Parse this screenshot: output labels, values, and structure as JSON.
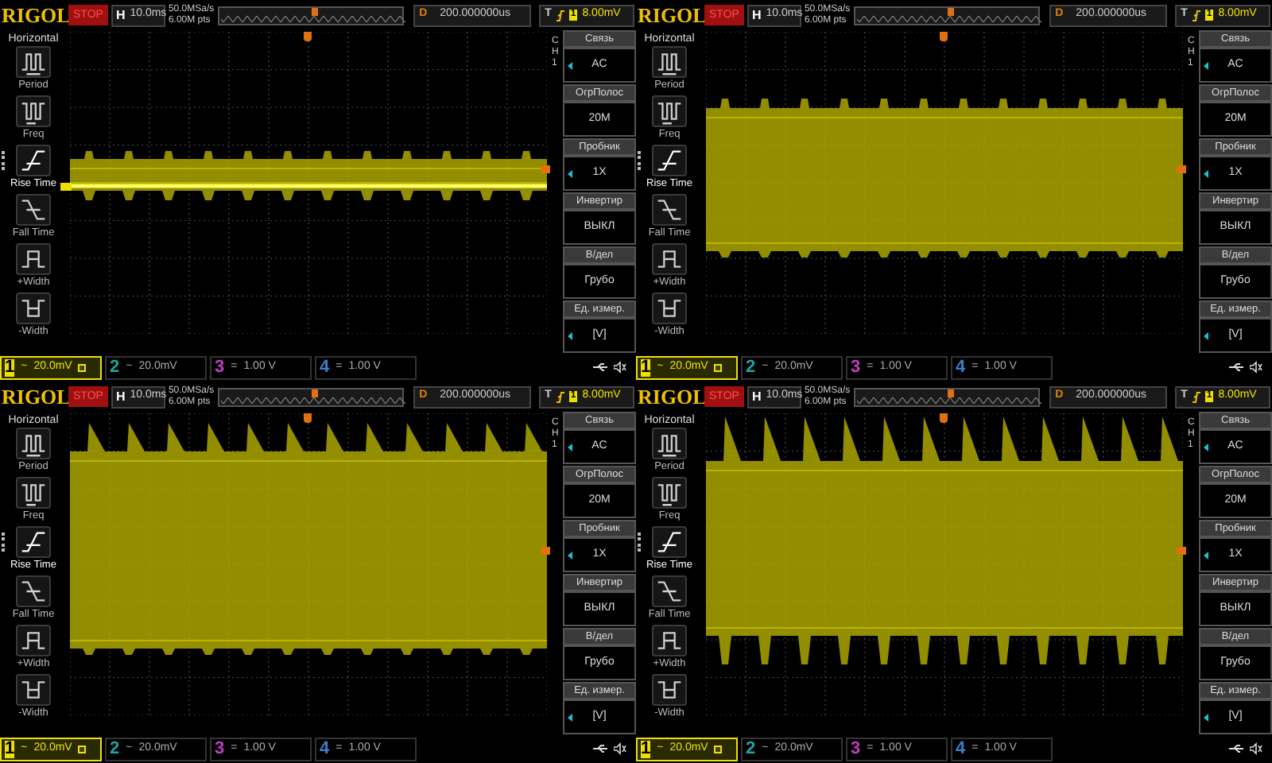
{
  "panels": [
    {
      "header": {
        "logo": "RIGOL",
        "run_state": "STOP",
        "timebase_label": "H",
        "timebase": "10.0ms",
        "sample_rate": "50.0MSa/s",
        "memory_depth": "6.00M pts",
        "delay_label": "D",
        "delay": "200.000000us",
        "trigger_label": "T",
        "trigger_source": "1",
        "trigger_level": "8.00mV"
      },
      "sidebar": {
        "title": "Horizontal",
        "items": [
          {
            "label": "Period",
            "kind": "period",
            "selected": false
          },
          {
            "label": "Freq",
            "kind": "freq",
            "selected": false
          },
          {
            "label": "Rise Time",
            "kind": "rise",
            "selected": true
          },
          {
            "label": "Fall Time",
            "kind": "fall",
            "selected": false
          },
          {
            "label": "+Width",
            "kind": "pwidth",
            "selected": false
          },
          {
            "label": "-Width",
            "kind": "nwidth",
            "selected": false
          }
        ]
      },
      "trace": {
        "kind": "ripple"
      },
      "channel_marker": true,
      "channel_label": "CH1",
      "menu": [
        {
          "title": "Связь",
          "value": "AC",
          "adjustable": true
        },
        {
          "title": "ОгрПолос",
          "value": "20M",
          "adjustable": false
        },
        {
          "title": "Пробник",
          "value": "1X",
          "adjustable": true
        },
        {
          "title": "Инвертир",
          "value": "ВЫКЛ",
          "adjustable": false
        },
        {
          "title": "В/дел",
          "value": "Грубо",
          "adjustable": false
        },
        {
          "title": "Ед. измер.",
          "value": "[V]",
          "adjustable": true
        }
      ],
      "channels": [
        {
          "number": "1",
          "coupling": "~",
          "scale": "20.0mV",
          "bw_limit": true,
          "selected": true,
          "color": "#f0e000"
        },
        {
          "number": "2",
          "coupling": "~",
          "scale": "20.0mV",
          "bw_limit": false,
          "selected": false,
          "color": "#1fa7a0"
        },
        {
          "number": "3",
          "coupling": "=",
          "scale": "1.00 V",
          "bw_limit": false,
          "selected": false,
          "color": "#c040c0"
        },
        {
          "number": "4",
          "coupling": "=",
          "scale": "1.00 V",
          "bw_limit": false,
          "selected": false,
          "color": "#3a7fd0"
        }
      ]
    },
    {
      "header": {
        "logo": "RIGOL",
        "run_state": "STOP",
        "timebase_label": "H",
        "timebase": "10.0ms",
        "sample_rate": "50.0MSa/s",
        "memory_depth": "6.00M pts",
        "delay_label": "D",
        "delay": "200.000000us",
        "trigger_label": "T",
        "trigger_source": "1",
        "trigger_level": "8.00mV"
      },
      "sidebar": {
        "title": "Horizontal",
        "items": [
          {
            "label": "Period",
            "kind": "period",
            "selected": false
          },
          {
            "label": "Freq",
            "kind": "freq",
            "selected": false
          },
          {
            "label": "Rise Time",
            "kind": "rise",
            "selected": true
          },
          {
            "label": "Fall Time",
            "kind": "fall",
            "selected": false
          },
          {
            "label": "+Width",
            "kind": "pwidth",
            "selected": false
          },
          {
            "label": "-Width",
            "kind": "nwidth",
            "selected": false
          }
        ]
      },
      "trace": {
        "kind": "band"
      },
      "channel_marker": false,
      "channel_label": "CH1",
      "menu": [
        {
          "title": "Связь",
          "value": "AC",
          "adjustable": true
        },
        {
          "title": "ОгрПолос",
          "value": "20M",
          "adjustable": false
        },
        {
          "title": "Пробник",
          "value": "1X",
          "adjustable": true
        },
        {
          "title": "Инвертир",
          "value": "ВЫКЛ",
          "adjustable": false
        },
        {
          "title": "В/дел",
          "value": "Грубо",
          "adjustable": false
        },
        {
          "title": "Ед. измер.",
          "value": "[V]",
          "adjustable": true
        }
      ],
      "channels": [
        {
          "number": "1",
          "coupling": "~",
          "scale": "20.0mV",
          "bw_limit": true,
          "selected": true,
          "color": "#f0e000"
        },
        {
          "number": "2",
          "coupling": "~",
          "scale": "20.0mV",
          "bw_limit": false,
          "selected": false,
          "color": "#1fa7a0"
        },
        {
          "number": "3",
          "coupling": "=",
          "scale": "1.00 V",
          "bw_limit": false,
          "selected": false,
          "color": "#c040c0"
        },
        {
          "number": "4",
          "coupling": "=",
          "scale": "1.00 V",
          "bw_limit": false,
          "selected": false,
          "color": "#3a7fd0"
        }
      ]
    },
    {
      "header": {
        "logo": "RIGOL",
        "run_state": "STOP",
        "timebase_label": "H",
        "timebase": "10.0ms",
        "sample_rate": "50.0MSa/s",
        "memory_depth": "6.00M pts",
        "delay_label": "D",
        "delay": "200.000000us",
        "trigger_label": "T",
        "trigger_source": "1",
        "trigger_level": "8.00mV"
      },
      "sidebar": {
        "title": "Horizontal",
        "items": [
          {
            "label": "Period",
            "kind": "period",
            "selected": false
          },
          {
            "label": "Freq",
            "kind": "freq",
            "selected": false
          },
          {
            "label": "Rise Time",
            "kind": "rise",
            "selected": true
          },
          {
            "label": "Fall Time",
            "kind": "fall",
            "selected": false
          },
          {
            "label": "+Width",
            "kind": "pwidth",
            "selected": false
          },
          {
            "label": "-Width",
            "kind": "nwidth",
            "selected": false
          }
        ]
      },
      "trace": {
        "kind": "sawtooth"
      },
      "channel_marker": false,
      "channel_label": "CH1",
      "menu": [
        {
          "title": "Связь",
          "value": "AC",
          "adjustable": true
        },
        {
          "title": "ОгрПолос",
          "value": "20M",
          "adjustable": false
        },
        {
          "title": "Пробник",
          "value": "1X",
          "adjustable": true
        },
        {
          "title": "Инвертир",
          "value": "ВЫКЛ",
          "adjustable": false
        },
        {
          "title": "В/дел",
          "value": "Грубо",
          "adjustable": false
        },
        {
          "title": "Ед. измер.",
          "value": "[V]",
          "adjustable": true
        }
      ],
      "channels": [
        {
          "number": "1",
          "coupling": "~",
          "scale": "20.0mV",
          "bw_limit": true,
          "selected": true,
          "color": "#f0e000"
        },
        {
          "number": "2",
          "coupling": "~",
          "scale": "20.0mV",
          "bw_limit": false,
          "selected": false,
          "color": "#1fa7a0"
        },
        {
          "number": "3",
          "coupling": "=",
          "scale": "1.00 V",
          "bw_limit": false,
          "selected": false,
          "color": "#c040c0"
        },
        {
          "number": "4",
          "coupling": "=",
          "scale": "1.00 V",
          "bw_limit": false,
          "selected": false,
          "color": "#3a7fd0"
        }
      ]
    },
    {
      "header": {
        "logo": "RIGOL",
        "run_state": "STOP",
        "timebase_label": "H",
        "timebase": "10.0ms",
        "sample_rate": "50.0MSa/s",
        "memory_depth": "6.00M pts",
        "delay_label": "D",
        "delay": "200.000000us",
        "trigger_label": "T",
        "trigger_source": "1",
        "trigger_level": "8.00mV"
      },
      "sidebar": {
        "title": "Horizontal",
        "items": [
          {
            "label": "Period",
            "kind": "period",
            "selected": false
          },
          {
            "label": "Freq",
            "kind": "freq",
            "selected": false
          },
          {
            "label": "Rise Time",
            "kind": "rise",
            "selected": true
          },
          {
            "label": "Fall Time",
            "kind": "fall",
            "selected": false
          },
          {
            "label": "+Width",
            "kind": "pwidth",
            "selected": false
          },
          {
            "label": "-Width",
            "kind": "nwidth",
            "selected": false
          }
        ]
      },
      "trace": {
        "kind": "tall"
      },
      "channel_marker": false,
      "channel_label": "CH1",
      "menu": [
        {
          "title": "Связь",
          "value": "AC",
          "adjustable": true
        },
        {
          "title": "ОгрПолос",
          "value": "20M",
          "adjustable": false
        },
        {
          "title": "Пробник",
          "value": "1X",
          "adjustable": true
        },
        {
          "title": "Инвертир",
          "value": "ВЫКЛ",
          "adjustable": false
        },
        {
          "title": "В/дел",
          "value": "Грубо",
          "adjustable": false
        },
        {
          "title": "Ед. измер.",
          "value": "[V]",
          "adjustable": true
        }
      ],
      "channels": [
        {
          "number": "1",
          "coupling": "~",
          "scale": "20.0mV",
          "bw_limit": true,
          "selected": true,
          "color": "#f0e000"
        },
        {
          "number": "2",
          "coupling": "~",
          "scale": "20.0mV",
          "bw_limit": false,
          "selected": false,
          "color": "#1fa7a0"
        },
        {
          "number": "3",
          "coupling": "=",
          "scale": "1.00 V",
          "bw_limit": false,
          "selected": false,
          "color": "#c040c0"
        },
        {
          "number": "4",
          "coupling": "=",
          "scale": "1.00 V",
          "bw_limit": false,
          "selected": false,
          "color": "#3a7fd0"
        }
      ]
    }
  ]
}
